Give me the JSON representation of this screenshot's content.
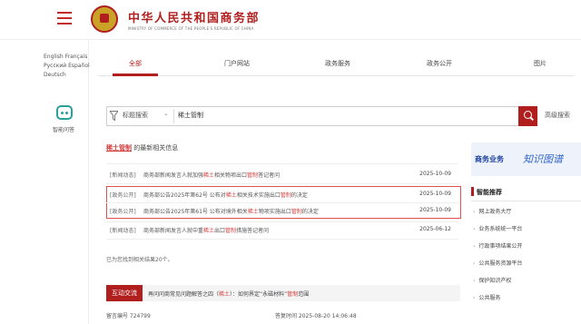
{
  "header": {
    "title_cn": "中华人民共和国商务部",
    "title_en": "MINISTRY OF COMMERCE OF THE PEOPLE'S REPUBLIC OF CHINA"
  },
  "sidebar": {
    "languages": [
      "English",
      "Français",
      "Русский",
      "Español",
      "Deutsch"
    ],
    "assistant_label": "智能问答"
  },
  "tabs": [
    {
      "label": "全部",
      "active": true
    },
    {
      "label": "门户网站",
      "active": false
    },
    {
      "label": "政务服务",
      "active": false
    },
    {
      "label": "政务公开",
      "active": false
    },
    {
      "label": "图片",
      "active": false
    }
  ],
  "search": {
    "type_label": "标题搜索",
    "value": "稀土管制",
    "advanced_label": "高级搜索"
  },
  "results": {
    "header_keyword": "稀土管制",
    "header_suffix": "的最新相关信息",
    "items": [
      {
        "tag": "[新闻动态]",
        "pre": "商务部新闻发言人就加强",
        "hl1": "稀土",
        "mid": "相关物项出口",
        "hl2": "管制",
        "post": "答记者问",
        "date": "2025-10-09"
      },
      {
        "tag": "[政务公开]",
        "pre": "商务部公告2025年第62号 公布对",
        "hl1": "稀土",
        "mid": "相关技术实施出口",
        "hl2": "管制",
        "post": "的决定",
        "date": "2025-10-09"
      },
      {
        "tag": "[政务公开]",
        "pre": "商务部公告2025年第61号 公布对境外相关",
        "hl1": "稀土",
        "mid": "物项实施出口",
        "hl2": "管制",
        "post": "的决定",
        "date": "2025-10-09"
      },
      {
        "tag": "[新闻动态]",
        "pre": "商务部新闻发言人就中重",
        "hl1": "稀土",
        "mid": "出口",
        "hl2": "管制",
        "post": "措施答记者问",
        "date": "2025-06-12"
      }
    ],
    "count_text": "已为您找到相关结果20个。"
  },
  "interactive": {
    "label": "互动交流",
    "title_pre": "再问问商常见问题解答之四（",
    "title_hl1": "稀土",
    "title_mid": "）：如何界定“永磁材料”",
    "title_hl2": "管制",
    "title_post": "范围",
    "message_no": "留言编号 724799",
    "reply_time": "答复时间 2025-08-20 14:06:48"
  },
  "right_panel": {
    "banner_text1": "商务业务",
    "banner_text2": "知识图谱",
    "recommend_title": "智能推荐",
    "items": [
      "网上政务大厅",
      "业务系统统一平台",
      "行政事项结果公开",
      "公共服务资源平台",
      "保护知识产权",
      "公共服务"
    ]
  },
  "colors": {
    "accent": "#b01e1e",
    "highlight": "#d23b3b",
    "teal": "#2aa09a",
    "blue": "#2f64c8"
  },
  "icons": [
    "menu-icon",
    "national-emblem-icon",
    "robot-icon",
    "filter-icon",
    "chevron-down-icon",
    "search-icon",
    "arrow-right-icon"
  ]
}
